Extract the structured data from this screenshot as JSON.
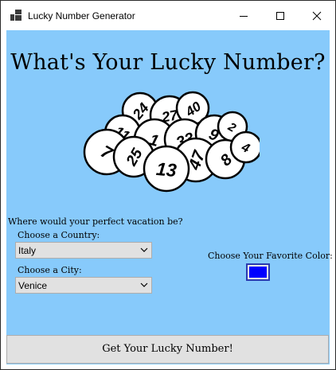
{
  "window": {
    "title": "Lucky Number Generator",
    "icon": "app-window-icon",
    "controls": [
      "minimize-icon",
      "maximize-icon",
      "close-icon"
    ]
  },
  "main": {
    "heading": "What's Your Lucky Number?",
    "balls": [
      "24",
      "27",
      "40",
      "11",
      "1",
      "33",
      "9",
      "2",
      "7",
      "25",
      "47",
      "8",
      "4",
      "13"
    ],
    "question": "Where would your perfect vacation be?",
    "country": {
      "label": "Choose a Country:",
      "value": "Italy"
    },
    "city": {
      "label": "Choose a City:",
      "value": "Venice"
    },
    "favorite_color": {
      "label": "Choose Your Favorite Color:",
      "value": "#0000ff"
    },
    "submit_label": "Get Your Lucky Number!"
  },
  "colors": {
    "background": "#87cafb",
    "button_face": "#e1e1e1",
    "swatch": "#0000ff"
  }
}
